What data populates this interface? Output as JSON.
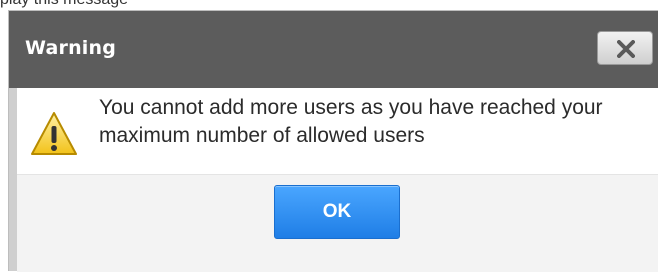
{
  "page_top_text": "play this message",
  "dialog": {
    "title": "Warning",
    "close_icon": "close-icon",
    "warning_icon": "warning-icon",
    "message": "You cannot add more users as you have reached your maximum number of allowed users",
    "ok_label": "OK"
  },
  "colors": {
    "titlebar": "#5c5c5c",
    "ok_button": "#2b8ff2",
    "footer": "#f3f3f3"
  }
}
